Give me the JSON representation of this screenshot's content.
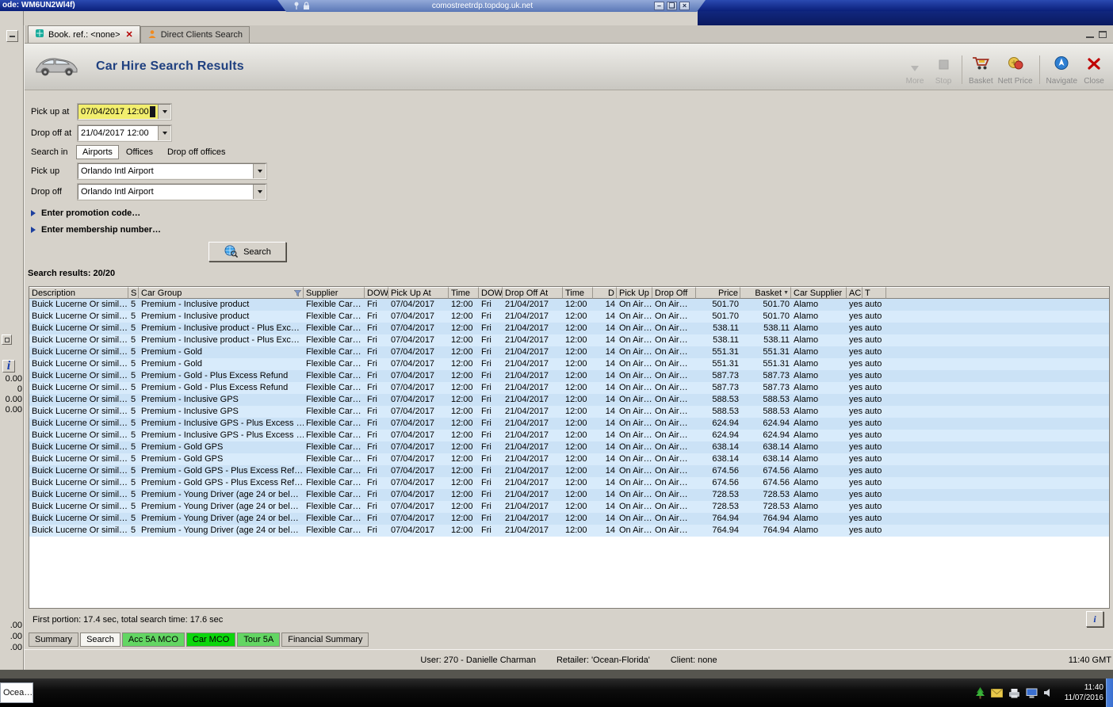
{
  "colors": {
    "accent-title": "#1f4080",
    "row-blue-a": "#cbe2f6",
    "row-blue-b": "#d8ebfb",
    "highlight-yellow": "#f2ee6e",
    "tab-green-bright": "#0cd60c",
    "tab-green-light": "#63d663",
    "taskbar-strip-blue": "#3a6fd0"
  },
  "remote_bar": {
    "session_title": "ode: WM6UN2Wl4f)",
    "host": "comostreetrdp.topdog.uk.net"
  },
  "tabs": [
    {
      "label": "Book. ref.: <none>"
    },
    {
      "label": "Direct Clients Search"
    }
  ],
  "header": {
    "title": "Car Hire Search Results",
    "toolbar": [
      {
        "label": "More"
      },
      {
        "label": "Stop"
      },
      {
        "label": "Basket"
      },
      {
        "label": "Nett Price"
      },
      {
        "label": "Navigate"
      },
      {
        "label": "Close"
      }
    ]
  },
  "form": {
    "pickup_at_label": "Pick up at",
    "pickup_at_value": "07/04/2017 12:00",
    "dropoff_at_label": "Drop off at",
    "dropoff_at_value": "21/04/2017 12:00",
    "search_in_label": "Search in",
    "search_in_tabs": [
      "Airports",
      "Offices",
      "Drop off offices"
    ],
    "pickup_label": "Pick up",
    "pickup_value": "Orlando Intl Airport",
    "dropoff_label": "Drop off",
    "dropoff_value": "Orlando Intl Airport",
    "promo_link": "Enter promotion code…",
    "membership_link": "Enter membership number…",
    "search_button": "Search"
  },
  "results": {
    "summary": "Search results: 20/20",
    "timing": "First portion: 17.4 sec, total search time: 17.6 sec"
  },
  "table": {
    "columns": [
      "Description",
      "S",
      "Car Group",
      "Supplier",
      "DOW",
      "Pick Up At",
      "Time",
      "DOW",
      "Drop Off At",
      "Time",
      "D",
      "Pick Up",
      "Drop Off",
      "Price",
      "Basket",
      "Car Supplier",
      "AC",
      "T"
    ],
    "rows": [
      [
        "Buick Lucerne Or simil…",
        "5",
        "Premium - Inclusive product",
        "Flexible Car…",
        "Fri",
        "07/04/2017",
        "12:00",
        "Fri",
        "21/04/2017",
        "12:00",
        "14",
        "On Air…",
        "On Air…",
        "501.70",
        "501.70",
        "Alamo",
        "yes",
        "auto"
      ],
      [
        "Buick Lucerne Or simil…",
        "5",
        "Premium - Inclusive product",
        "Flexible Car…",
        "Fri",
        "07/04/2017",
        "12:00",
        "Fri",
        "21/04/2017",
        "12:00",
        "14",
        "On Air…",
        "On Air…",
        "501.70",
        "501.70",
        "Alamo",
        "yes",
        "auto"
      ],
      [
        "Buick Lucerne Or simil…",
        "5",
        "Premium - Inclusive product - Plus Exc…",
        "Flexible Car…",
        "Fri",
        "07/04/2017",
        "12:00",
        "Fri",
        "21/04/2017",
        "12:00",
        "14",
        "On Air…",
        "On Air…",
        "538.11",
        "538.11",
        "Alamo",
        "yes",
        "auto"
      ],
      [
        "Buick Lucerne Or simil…",
        "5",
        "Premium - Inclusive product - Plus Exc…",
        "Flexible Car…",
        "Fri",
        "07/04/2017",
        "12:00",
        "Fri",
        "21/04/2017",
        "12:00",
        "14",
        "On Air…",
        "On Air…",
        "538.11",
        "538.11",
        "Alamo",
        "yes",
        "auto"
      ],
      [
        "Buick Lucerne Or simil…",
        "5",
        "Premium - Gold",
        "Flexible Car…",
        "Fri",
        "07/04/2017",
        "12:00",
        "Fri",
        "21/04/2017",
        "12:00",
        "14",
        "On Air…",
        "On Air…",
        "551.31",
        "551.31",
        "Alamo",
        "yes",
        "auto"
      ],
      [
        "Buick Lucerne Or simil…",
        "5",
        "Premium - Gold",
        "Flexible Car…",
        "Fri",
        "07/04/2017",
        "12:00",
        "Fri",
        "21/04/2017",
        "12:00",
        "14",
        "On Air…",
        "On Air…",
        "551.31",
        "551.31",
        "Alamo",
        "yes",
        "auto"
      ],
      [
        "Buick Lucerne Or simil…",
        "5",
        "Premium - Gold - Plus Excess Refund",
        "Flexible Car…",
        "Fri",
        "07/04/2017",
        "12:00",
        "Fri",
        "21/04/2017",
        "12:00",
        "14",
        "On Air…",
        "On Air…",
        "587.73",
        "587.73",
        "Alamo",
        "yes",
        "auto"
      ],
      [
        "Buick Lucerne Or simil…",
        "5",
        "Premium - Gold - Plus Excess Refund",
        "Flexible Car…",
        "Fri",
        "07/04/2017",
        "12:00",
        "Fri",
        "21/04/2017",
        "12:00",
        "14",
        "On Air…",
        "On Air…",
        "587.73",
        "587.73",
        "Alamo",
        "yes",
        "auto"
      ],
      [
        "Buick Lucerne Or simil…",
        "5",
        "Premium - Inclusive GPS",
        "Flexible Car…",
        "Fri",
        "07/04/2017",
        "12:00",
        "Fri",
        "21/04/2017",
        "12:00",
        "14",
        "On Air…",
        "On Air…",
        "588.53",
        "588.53",
        "Alamo",
        "yes",
        "auto"
      ],
      [
        "Buick Lucerne Or simil…",
        "5",
        "Premium - Inclusive GPS",
        "Flexible Car…",
        "Fri",
        "07/04/2017",
        "12:00",
        "Fri",
        "21/04/2017",
        "12:00",
        "14",
        "On Air…",
        "On Air…",
        "588.53",
        "588.53",
        "Alamo",
        "yes",
        "auto"
      ],
      [
        "Buick Lucerne Or simil…",
        "5",
        "Premium - Inclusive GPS - Plus Excess …",
        "Flexible Car…",
        "Fri",
        "07/04/2017",
        "12:00",
        "Fri",
        "21/04/2017",
        "12:00",
        "14",
        "On Air…",
        "On Air…",
        "624.94",
        "624.94",
        "Alamo",
        "yes",
        "auto"
      ],
      [
        "Buick Lucerne Or simil…",
        "5",
        "Premium - Inclusive GPS - Plus Excess …",
        "Flexible Car…",
        "Fri",
        "07/04/2017",
        "12:00",
        "Fri",
        "21/04/2017",
        "12:00",
        "14",
        "On Air…",
        "On Air…",
        "624.94",
        "624.94",
        "Alamo",
        "yes",
        "auto"
      ],
      [
        "Buick Lucerne Or simil…",
        "5",
        "Premium - Gold GPS",
        "Flexible Car…",
        "Fri",
        "07/04/2017",
        "12:00",
        "Fri",
        "21/04/2017",
        "12:00",
        "14",
        "On Air…",
        "On Air…",
        "638.14",
        "638.14",
        "Alamo",
        "yes",
        "auto"
      ],
      [
        "Buick Lucerne Or simil…",
        "5",
        "Premium - Gold GPS",
        "Flexible Car…",
        "Fri",
        "07/04/2017",
        "12:00",
        "Fri",
        "21/04/2017",
        "12:00",
        "14",
        "On Air…",
        "On Air…",
        "638.14",
        "638.14",
        "Alamo",
        "yes",
        "auto"
      ],
      [
        "Buick Lucerne Or simil…",
        "5",
        "Premium - Gold GPS - Plus Excess Ref…",
        "Flexible Car…",
        "Fri",
        "07/04/2017",
        "12:00",
        "Fri",
        "21/04/2017",
        "12:00",
        "14",
        "On Air…",
        "On Air…",
        "674.56",
        "674.56",
        "Alamo",
        "yes",
        "auto"
      ],
      [
        "Buick Lucerne Or simil…",
        "5",
        "Premium - Gold GPS - Plus Excess Ref…",
        "Flexible Car…",
        "Fri",
        "07/04/2017",
        "12:00",
        "Fri",
        "21/04/2017",
        "12:00",
        "14",
        "On Air…",
        "On Air…",
        "674.56",
        "674.56",
        "Alamo",
        "yes",
        "auto"
      ],
      [
        "Buick Lucerne Or simil…",
        "5",
        "Premium - Young Driver (age 24 or bel…",
        "Flexible Car…",
        "Fri",
        "07/04/2017",
        "12:00",
        "Fri",
        "21/04/2017",
        "12:00",
        "14",
        "On Air…",
        "On Air…",
        "728.53",
        "728.53",
        "Alamo",
        "yes",
        "auto"
      ],
      [
        "Buick Lucerne Or simil…",
        "5",
        "Premium - Young Driver (age 24 or bel…",
        "Flexible Car…",
        "Fri",
        "07/04/2017",
        "12:00",
        "Fri",
        "21/04/2017",
        "12:00",
        "14",
        "On Air…",
        "On Air…",
        "728.53",
        "728.53",
        "Alamo",
        "yes",
        "auto"
      ],
      [
        "Buick Lucerne Or simil…",
        "5",
        "Premium - Young Driver (age 24 or bel…",
        "Flexible Car…",
        "Fri",
        "07/04/2017",
        "12:00",
        "Fri",
        "21/04/2017",
        "12:00",
        "14",
        "On Air…",
        "On Air…",
        "764.94",
        "764.94",
        "Alamo",
        "yes",
        "auto"
      ],
      [
        "Buick Lucerne Or simil…",
        "5",
        "Premium - Young Driver (age 24 or bel…",
        "Flexible Car…",
        "Fri",
        "07/04/2017",
        "12:00",
        "Fri",
        "21/04/2017",
        "12:00",
        "14",
        "On Air…",
        "On Air…",
        "764.94",
        "764.94",
        "Alamo",
        "yes",
        "auto"
      ]
    ]
  },
  "bottom_tabs": [
    {
      "label": "Summary"
    },
    {
      "label": "Search"
    },
    {
      "label": "Acc 5A MCO"
    },
    {
      "label": "Car MCO"
    },
    {
      "label": "Tour 5A"
    },
    {
      "label": "Financial Summary"
    }
  ],
  "status_bar": {
    "user": "User: 270 - Danielle Charman",
    "retailer": "Retailer: 'Ocean-Florida'",
    "client": "Client: none",
    "time": "11:40 GMT"
  },
  "taskbar": {
    "app_button": "Ocea…",
    "clock_time": "11:40",
    "clock_date": "11/07/2016"
  },
  "left_fragments": {
    "mid": [
      "0.00",
      "0",
      "0.00",
      "0.00"
    ],
    "bottom": [
      ".00",
      ".00",
      ".00"
    ]
  }
}
